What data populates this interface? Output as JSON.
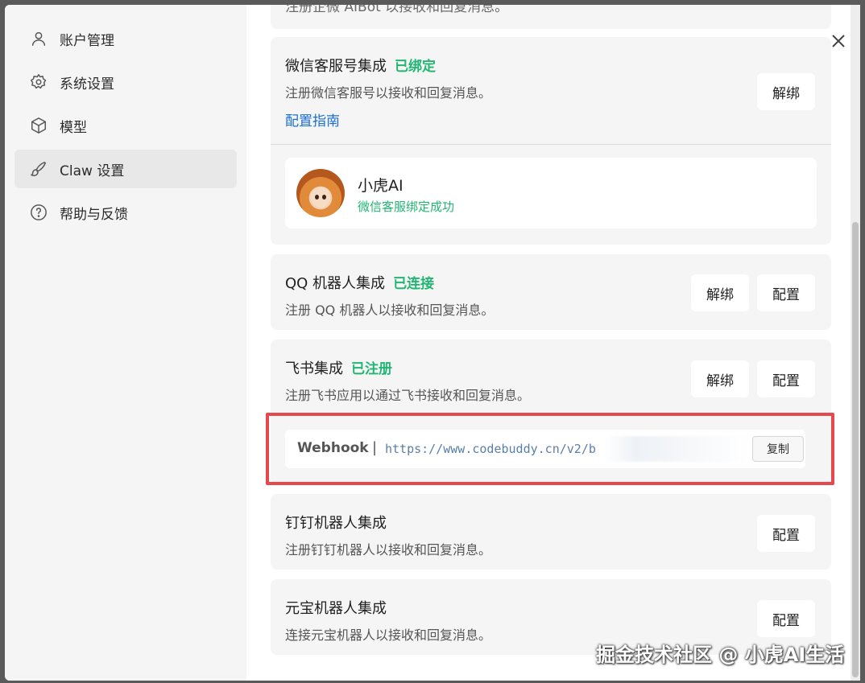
{
  "sidebar": {
    "items": [
      {
        "label": "账户管理",
        "icon": "user-icon"
      },
      {
        "label": "系统设置",
        "icon": "gear-icon"
      },
      {
        "label": "模型",
        "icon": "cube-icon"
      },
      {
        "label": "Claw 设置",
        "icon": "brush-icon",
        "active": true
      },
      {
        "label": "帮助与反馈",
        "icon": "question-icon"
      }
    ]
  },
  "top_partial_text": "注册企微 AIBot 以接收和回复消息。",
  "wechat": {
    "title": "微信客服号集成",
    "status": "已绑定",
    "desc": "注册微信客服号以接收和回复消息。",
    "guide_link": "配置指南",
    "unbind_label": "解绑",
    "profile_name": "小虎AI",
    "profile_status": "微信客服绑定成功"
  },
  "qq": {
    "title": "QQ 机器人集成",
    "status": "已连接",
    "desc": "注册 QQ 机器人以接收和回复消息。",
    "unbind_label": "解绑",
    "config_label": "配置"
  },
  "feishu": {
    "title": "飞书集成",
    "status": "已注册",
    "desc": "注册飞书应用以通过飞书接收和回复消息。",
    "unbind_label": "解绑",
    "config_label": "配置",
    "webhook_label": "Webhook",
    "webhook_sep": "|",
    "webhook_url": "https://www.codebuddy.cn/v2/b",
    "copy_label": "复制"
  },
  "dingtalk": {
    "title": "钉钉机器人集成",
    "desc": "注册钉钉机器人以接收和回复消息。",
    "config_label": "配置"
  },
  "yuanbao": {
    "title": "元宝机器人集成",
    "desc": "连接元宝机器人以接收和回复消息。",
    "config_label": "配置"
  },
  "watermark": "掘金技术社区 @ 小虎AI生活",
  "colors": {
    "status_green": "#22b573",
    "link_blue": "#1a6fd1",
    "highlight_red": "#e5484d"
  }
}
